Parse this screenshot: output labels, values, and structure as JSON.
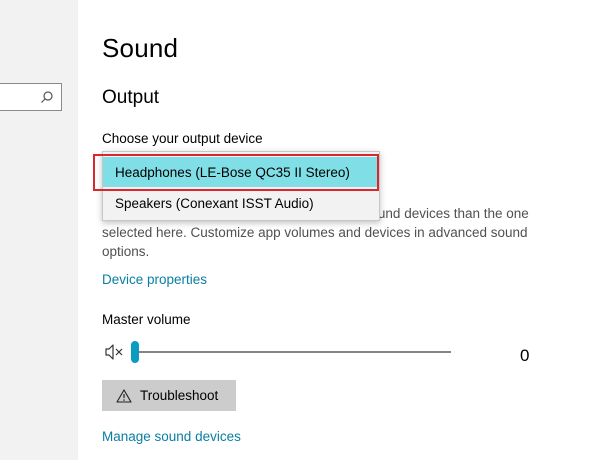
{
  "page": {
    "title": "Sound"
  },
  "output": {
    "section_title": "Output",
    "device_label": "Choose your output device",
    "device_options": [
      "Headphones (LE-Bose QC35 II Stereo)",
      "Speakers (Conexant ISST Audio)"
    ],
    "selected_device": "Headphones (LE-Bose QC35 II Stereo)",
    "description_visible": "ound devices than the one selected here. Customize app volumes and devices in advanced sound options.",
    "device_properties_link": "Device properties",
    "master_volume_label": "Master volume",
    "master_volume_value": "0",
    "master_volume_level": 0,
    "muted": true,
    "troubleshoot_label": "Troubleshoot",
    "manage_devices_link": "Manage sound devices"
  },
  "icons": {
    "search": "search-icon",
    "speaker_muted": "speaker-muted-icon",
    "warning": "warning-icon"
  },
  "colors": {
    "accent": "#0a9cc0",
    "link": "#0a7ea4",
    "selection": "#80dfe6",
    "annotation": "#d9262f"
  }
}
